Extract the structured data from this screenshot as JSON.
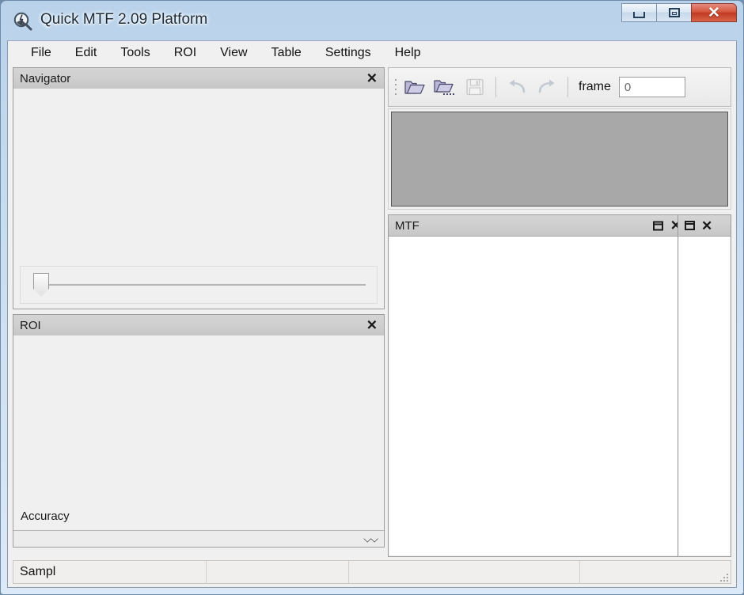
{
  "window": {
    "title": "Quick MTF 2.09 Platform",
    "app_icon": "magnifier-lens-icon",
    "controls": {
      "minimize": "minimize-icon",
      "restore": "restore-icon",
      "close": "close-icon"
    }
  },
  "menubar": {
    "items": [
      {
        "label": "File"
      },
      {
        "label": "Edit"
      },
      {
        "label": "Tools"
      },
      {
        "label": "ROI"
      },
      {
        "label": "View"
      },
      {
        "label": "Table"
      },
      {
        "label": "Settings"
      },
      {
        "label": "Help"
      }
    ]
  },
  "toolbar": {
    "grip": "drag-grip-icon",
    "buttons": [
      {
        "name": "open-file-icon",
        "enabled": true
      },
      {
        "name": "open-batch-icon",
        "enabled": true
      },
      {
        "name": "save-icon",
        "enabled": false
      },
      {
        "name": "undo-icon",
        "enabled": false
      },
      {
        "name": "redo-icon",
        "enabled": false
      }
    ],
    "frame_label": "frame",
    "frame_value": "0",
    "frame_placeholder": ""
  },
  "preview": {
    "name": "image-preview",
    "background_color": "#a8a8a8"
  },
  "panels": {
    "navigator": {
      "title": "Navigator",
      "close_icon": "close-icon",
      "slider": {
        "name": "zoom-slider",
        "value": "0",
        "min": "0",
        "max": "100"
      }
    },
    "roi": {
      "title": "ROI",
      "close_icon": "close-icon",
      "accuracy_label": "Accuracy",
      "expand_icon": "chevron-double-down-icon"
    },
    "mtf": {
      "title": "MTF",
      "restore_icon": "restore-icon",
      "close_icon": "close-icon"
    },
    "side": {
      "restore_icon": "restore-icon",
      "close_icon": "close-icon"
    }
  },
  "statusbar": {
    "cells": [
      {
        "text": "Sampl"
      },
      {
        "text": ""
      },
      {
        "text": ""
      },
      {
        "text": ""
      }
    ],
    "resize_grip": "resize-grip-icon"
  },
  "colors": {
    "title_gradient_top": "#b9d2ea",
    "title_gradient_bottom": "#dce9f6",
    "close_button": "#bf3a22",
    "panel_header": "#cfcfcf",
    "app_background": "#f0f0f0",
    "preview_gray": "#a8a8a8"
  }
}
